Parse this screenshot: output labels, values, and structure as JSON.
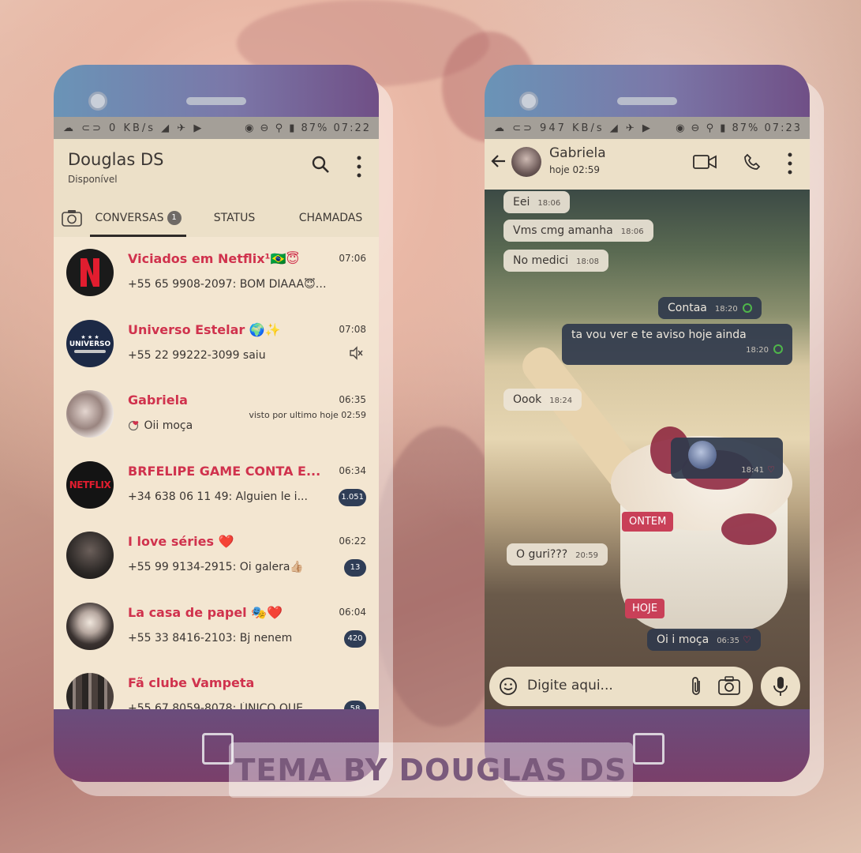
{
  "phone1": {
    "status": {
      "left": "☁ ⊂⊃ 0 KB/s ◢ ✈ ▶",
      "right": "◉ ⊖ ⚲ ▮ 87% 07:22"
    },
    "header": {
      "title": "Douglas DS",
      "subtitle": "Disponível"
    },
    "tabs": {
      "conversas": "CONVERSAS",
      "conversas_badge": "1",
      "status": "STATUS",
      "chamadas": "CHAMADAS"
    },
    "chats": [
      {
        "name": "Viciados em Netflix¹🇧🇷😇",
        "time": "07:06",
        "message": "+55 65 9908-2097: BOM DIAAA😇🥖",
        "avatar": "netflix-n"
      },
      {
        "name": "Universo Estelar 🌍✨",
        "time": "07:08",
        "message": "+55 22 99222-3099 saiu",
        "avatar": "universo",
        "avatar_text": "UNIVERSO"
      },
      {
        "name": "Gabriela",
        "time": "06:35",
        "message": "Oii moça",
        "seen": "visto por ultimo hoje 02:59",
        "avatar": "photo"
      },
      {
        "name": "BRFELIPE GAME CONTA E...",
        "time": "06:34",
        "message": "+34 638 06 11 49: Alguien le i...",
        "count": "1.051",
        "avatar": "netflix-logo",
        "avatar_text": "NETFLIX"
      },
      {
        "name": "I love séries ❤️",
        "time": "06:22",
        "message": "+55 99 9134-2915: Oi galera👍🏼",
        "count": "13",
        "avatar": "photo"
      },
      {
        "name": "La casa de papel 🎭❤️",
        "time": "06:04",
        "message": "+55 33 8416-2103: Bj nenem",
        "count": "420",
        "avatar": "photo"
      },
      {
        "name": "Fã clube Vampeta",
        "time": "",
        "message": "+55 67 8059-8078: ÚNICO QUE...",
        "count": "58",
        "avatar": "photo"
      }
    ]
  },
  "phone2": {
    "status": {
      "left": "☁ ⊂⊃ 947 KB/s ◢ ✈ ▶",
      "right": "◉ ⊖ ⚲ ▮ 87% 07:23"
    },
    "contact": {
      "name": "Gabriela",
      "subtitle": "hoje 02:59"
    },
    "messages": [
      {
        "text": "Eei",
        "time": "18:06"
      },
      {
        "text": "Vms cmg amanha",
        "time": "18:06"
      },
      {
        "text": "No medici",
        "time": "18:08"
      },
      {
        "text": "Contaa",
        "time": "18:20"
      },
      {
        "text": "ta vou ver e te aviso hoje ainda",
        "time": "18:20"
      },
      {
        "text": "Oook",
        "time": "18:24"
      },
      {
        "text": "",
        "time": "18:41"
      },
      {
        "text": "O guri???",
        "time": "20:59"
      },
      {
        "text": "Oi i moça",
        "time": "06:35"
      }
    ],
    "days": {
      "ontem": "ONTEM",
      "hoje": "HOJE"
    },
    "input": {
      "placeholder": "Digite aqui..."
    }
  },
  "watermark": "TEMA BY DOUGLAS DS",
  "colors": {
    "accent": "#d0324d",
    "badge": "#2f3d56",
    "surface": "#ece0c8",
    "top": "#7b77a8",
    "bottom": "#7a3f6a"
  }
}
